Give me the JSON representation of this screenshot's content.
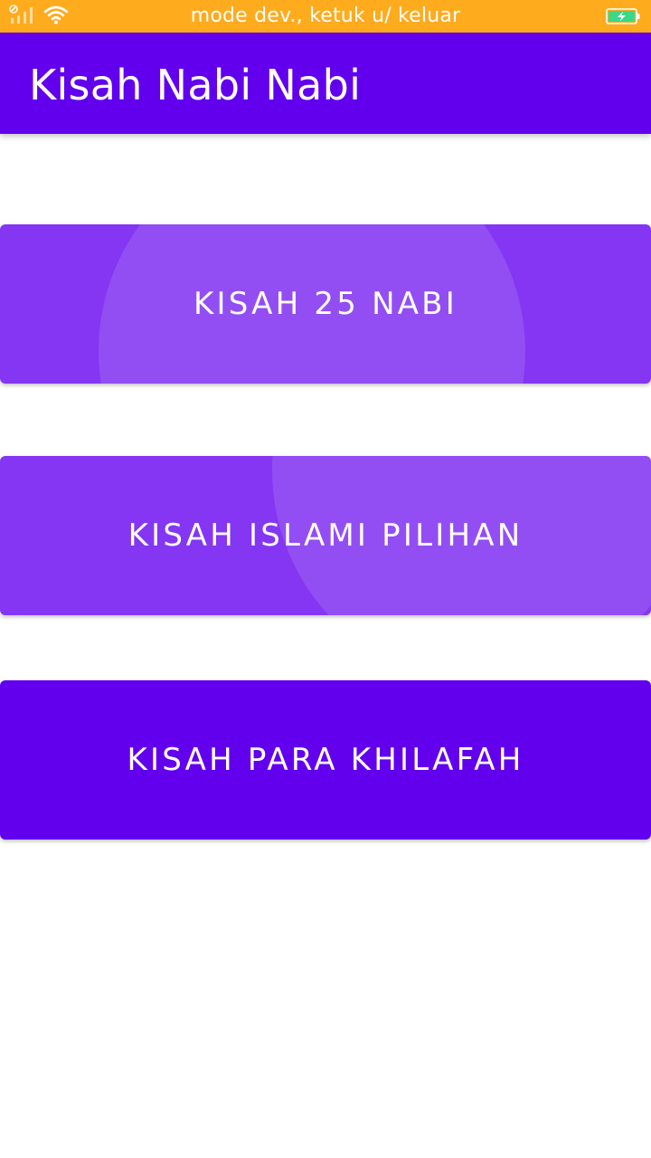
{
  "status_bar": {
    "text": "mode dev., ketuk u/ keluar",
    "background": "#FFAB1E",
    "icons": [
      "signal-icon",
      "wifi-icon",
      "battery-charging-icon"
    ]
  },
  "app_bar": {
    "title": "Kisah Nabi Nabi",
    "background": "#6200EE"
  },
  "menu": {
    "buttons": [
      {
        "label": "KISAH 25 NABI",
        "state": "pressed-ripple",
        "color": "#8436F2"
      },
      {
        "label": "KISAH ISLAMI PILIHAN",
        "state": "pressed-ripple",
        "color": "#8436F2"
      },
      {
        "label": "KISAH PARA KHILAFAH",
        "state": "normal",
        "color": "#6200EE"
      }
    ]
  }
}
